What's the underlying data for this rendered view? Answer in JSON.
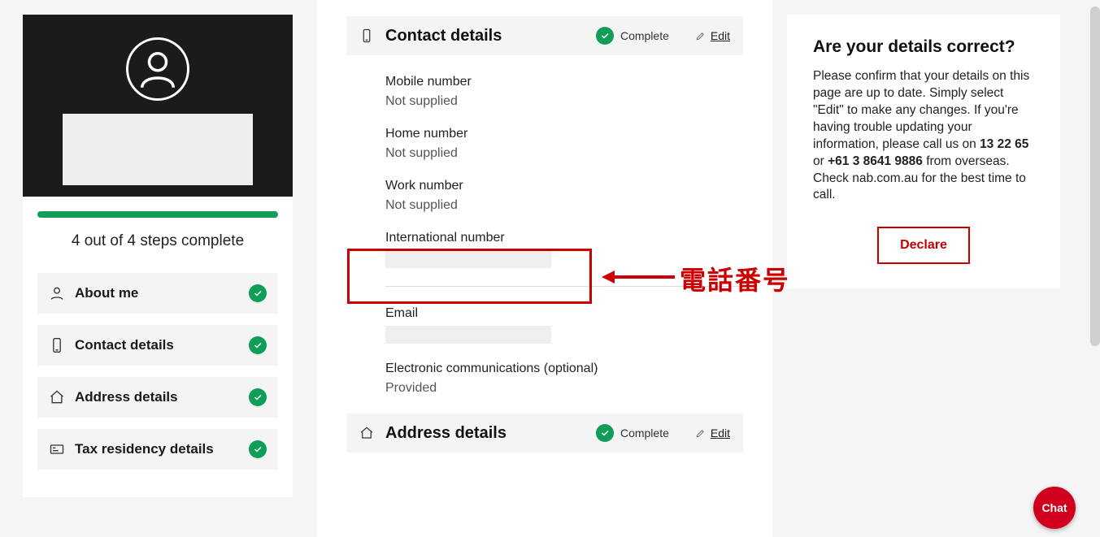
{
  "sidebar": {
    "progress_text": "4 out of 4 steps complete",
    "steps": [
      {
        "label": "About me"
      },
      {
        "label": "Contact details"
      },
      {
        "label": "Address details"
      },
      {
        "label": "Tax residency details"
      }
    ]
  },
  "main": {
    "contact_section": {
      "title": "Contact details",
      "status": "Complete",
      "edit": "Edit",
      "fields": {
        "mobile_label": "Mobile number",
        "mobile_value": "Not supplied",
        "home_label": "Home number",
        "home_value": "Not supplied",
        "work_label": "Work number",
        "work_value": "Not supplied",
        "intl_label": "International number",
        "email_label": "Email",
        "ecom_label": "Electronic communications (optional)",
        "ecom_value": "Provided"
      }
    },
    "address_section": {
      "title": "Address details",
      "status": "Complete",
      "edit": "Edit"
    }
  },
  "right": {
    "title": "Are your details correct?",
    "body_pre": "Please confirm that your details on this page are up to date. Simply select \"Edit\" to make any changes. If you're having trouble updating your information, please call us on ",
    "num1": "13 22 65",
    "body_mid": " or ",
    "num2": "+61 3 8641 9886",
    "body_post": " from overseas. Check nab.com.au for the best time to call.",
    "declare": "Declare"
  },
  "chat": {
    "label": "Chat"
  },
  "annotation": {
    "text": "電話番号"
  }
}
